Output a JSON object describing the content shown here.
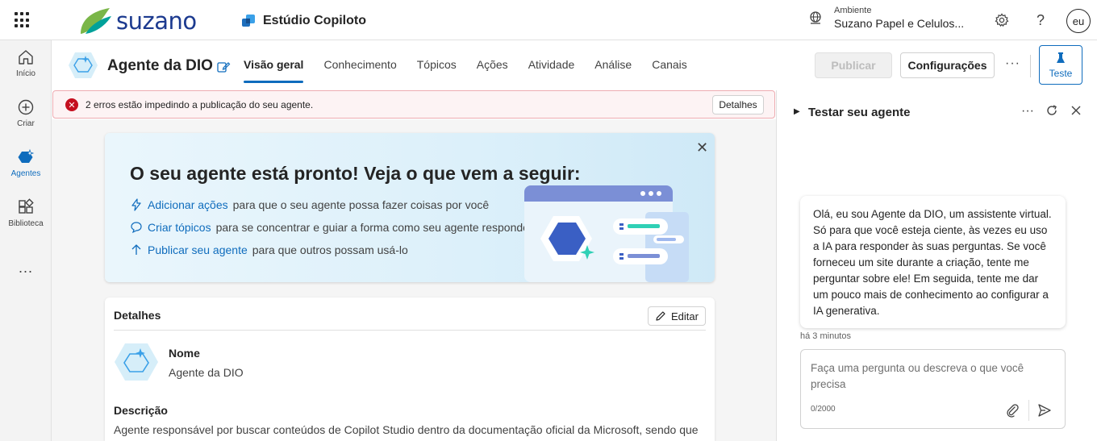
{
  "topbar": {
    "brand": "suzano",
    "product": "Estúdio Copiloto",
    "env_label": "Ambiente",
    "env_value": "Suzano Papel e Celulos...",
    "avatar": "eu",
    "icons": [
      "app-launcher-icon",
      "globe-icon",
      "gear-icon",
      "help-icon"
    ]
  },
  "rail": {
    "items": [
      {
        "label": "Início",
        "icon": "home-icon"
      },
      {
        "label": "Criar",
        "icon": "plus-circle-icon"
      },
      {
        "label": "Agentes",
        "icon": "agents-icon",
        "active": true
      },
      {
        "label": "Biblioteca",
        "icon": "library-icon"
      }
    ],
    "more": "..."
  },
  "agent": {
    "name": "Agente da DIO",
    "tabs": [
      "Visão geral",
      "Conhecimento",
      "Tópicos",
      "Ações",
      "Atividade",
      "Análise",
      "Canais"
    ],
    "active_tab": "Visão geral",
    "publish": "Publicar",
    "config": "Configurações",
    "more": "···",
    "test": "Teste"
  },
  "error": {
    "text": "2 erros estão impedindo a publicação do seu agente.",
    "button": "Detalhes"
  },
  "banner": {
    "title": "O seu agente está pronto! Veja o que vem a seguir:",
    "lines": [
      {
        "link": "Adicionar ações",
        "text": "para que o seu agente possa fazer coisas por você"
      },
      {
        "link": "Criar tópicos",
        "text": "para se concentrar e guiar a forma como seu agente responde"
      },
      {
        "link": "Publicar seu agente",
        "text": "para que outros possam usá-lo"
      }
    ]
  },
  "details": {
    "title": "Detalhes",
    "edit": "Editar",
    "name_label": "Nome",
    "name_value": "Agente da DIO",
    "desc_label": "Descrição",
    "desc_value": "Agente responsável por buscar conteúdos de Copilot Studio dentro da documentação oficial da Microsoft, sendo que"
  },
  "test_panel": {
    "title": "Testar seu agente",
    "message": "Olá, eu sou Agente da DIO, um assistente virtual. Só para que você esteja ciente, às vezes eu uso a IA para responder às suas perguntas. Se você forneceu um site durante a criação, tente me perguntar sobre ele! Em seguida, tente me dar um pouco mais de conhecimento ao configurar a IA generativa.",
    "timestamp": "há 3 minutos",
    "placeholder": "Faça uma pergunta ou descreva o que você precisa",
    "counter": "0/2000"
  },
  "colors": {
    "accent": "#0f6cbd",
    "brand": "#1c3a8f",
    "error": "#c50f1f"
  }
}
